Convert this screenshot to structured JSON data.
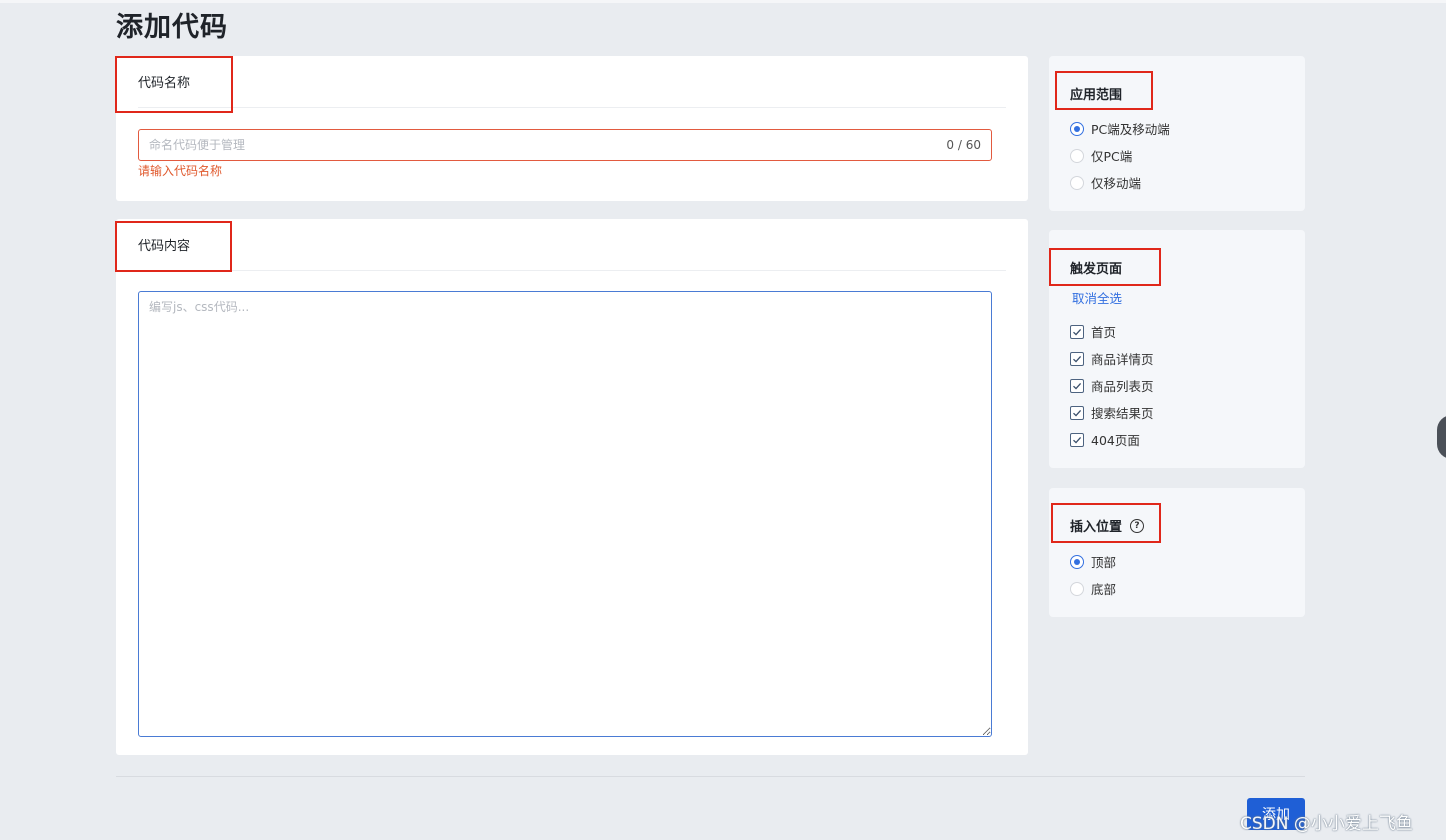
{
  "page": {
    "title": "添加代码"
  },
  "code_name": {
    "header": "代码名称",
    "placeholder": "命名代码便于管理",
    "value": "",
    "counter": "0 / 60",
    "error": "请输入代码名称"
  },
  "code_content": {
    "header": "代码内容",
    "placeholder": "编写js、css代码..."
  },
  "scope": {
    "title": "应用范围",
    "options": [
      {
        "label": "PC端及移动端",
        "selected": true
      },
      {
        "label": "仅PC端",
        "selected": false
      },
      {
        "label": "仅移动端",
        "selected": false
      }
    ]
  },
  "trigger": {
    "title": "触发页面",
    "deselect_all": "取消全选",
    "pages": [
      {
        "label": "首页",
        "checked": true
      },
      {
        "label": "商品详情页",
        "checked": true
      },
      {
        "label": "商品列表页",
        "checked": true
      },
      {
        "label": "搜索结果页",
        "checked": true
      },
      {
        "label": "404页面",
        "checked": true
      }
    ]
  },
  "position": {
    "title": "插入位置",
    "help_icon": "?",
    "options": [
      {
        "label": "顶部",
        "selected": true
      },
      {
        "label": "底部",
        "selected": false
      }
    ]
  },
  "footer": {
    "add_label": "添加"
  },
  "watermark": "CSDN @小小爱上飞鱼",
  "colors": {
    "accent": "#3370e0",
    "error": "#e0592d",
    "highlight": "#e0271a",
    "primary_button": "#1f5fd6"
  }
}
